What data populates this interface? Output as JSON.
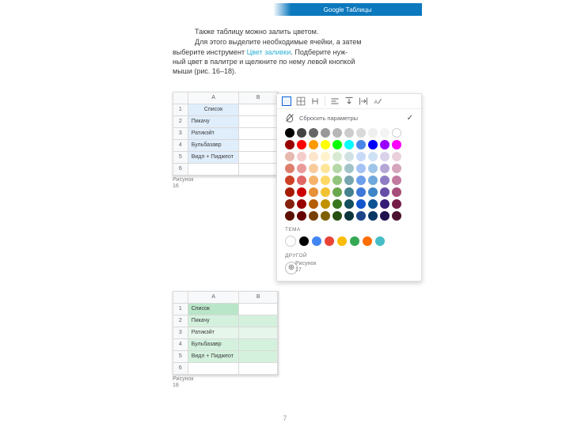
{
  "header": {
    "title": "Google Таблицы"
  },
  "page_number": "7",
  "text": {
    "p1": "Также таблицу можно залить цветом.",
    "p2": "Для этого выделите необходимые ячейки, а затем",
    "p3_a": "выберите инструмент ",
    "p3_b": "Цвет заливки",
    "p3_c": ". Подберите нуж-",
    "p4": "ный цвет в палитре и щелкните по нему левой кнопкой",
    "p5": "мыши (рис. 16–18)."
  },
  "captions": {
    "f16a": "Рисунок",
    "f16b": "16",
    "f17a": "Рисунок",
    "f17b": "17",
    "f18a": "Рисунок",
    "f18b": "18"
  },
  "sheet": {
    "col_a": "A",
    "col_b": "B",
    "r1": "1",
    "r2": "2",
    "r3": "3",
    "r4": "4",
    "r5": "5",
    "r6": "6",
    "head": "Список",
    "row2": "Пикачу",
    "row3": "Ратикэйт",
    "row4": "Бульбазавр",
    "row5": "Видл + Пиджеот"
  },
  "picker": {
    "reset_label": "Сбросить параметры",
    "theme_label": "ТЕМА",
    "other_label": "ДРУГОЙ",
    "main_colors": [
      "#000000",
      "#434343",
      "#666666",
      "#999999",
      "#b7b7b7",
      "#cccccc",
      "#d9d9d9",
      "#efefef",
      "#f3f3f3",
      "#ffffff",
      "#980000",
      "#ff0000",
      "#ff9900",
      "#ffff00",
      "#00ff00",
      "#00ffff",
      "#4a86e8",
      "#0000ff",
      "#9900ff",
      "#ff00ff",
      "#e6b8af",
      "#f4cccc",
      "#fce5cd",
      "#fff2cc",
      "#d9ead3",
      "#d0e0e3",
      "#c9daf8",
      "#cfe2f3",
      "#d9d2e9",
      "#ead1dc",
      "#dd7e6b",
      "#ea9999",
      "#f9cb9c",
      "#ffe599",
      "#b6d7a8",
      "#a2c4c9",
      "#a4c2f4",
      "#9fc5e8",
      "#b4a7d6",
      "#d5a6bd",
      "#cc4125",
      "#e06666",
      "#f6b26b",
      "#ffd966",
      "#93c47d",
      "#76a5af",
      "#6d9eeb",
      "#6fa8dc",
      "#8e7cc3",
      "#c27ba0",
      "#a61c00",
      "#cc0000",
      "#e69138",
      "#f1c232",
      "#6aa84f",
      "#45818e",
      "#3c78d8",
      "#3d85c6",
      "#674ea7",
      "#a64d79",
      "#85200c",
      "#990000",
      "#b45f06",
      "#bf9000",
      "#38761d",
      "#134f5c",
      "#1155cc",
      "#0b5394",
      "#351c75",
      "#741b47",
      "#5b0f00",
      "#660000",
      "#783f04",
      "#7f6000",
      "#274e13",
      "#0c343d",
      "#1c4587",
      "#073763",
      "#20124d",
      "#4c1130"
    ],
    "theme_colors": [
      "#ffffff",
      "#000000",
      "#4285f4",
      "#ea4335",
      "#fbbc04",
      "#34a853",
      "#ff6d01",
      "#46bdc6"
    ]
  }
}
